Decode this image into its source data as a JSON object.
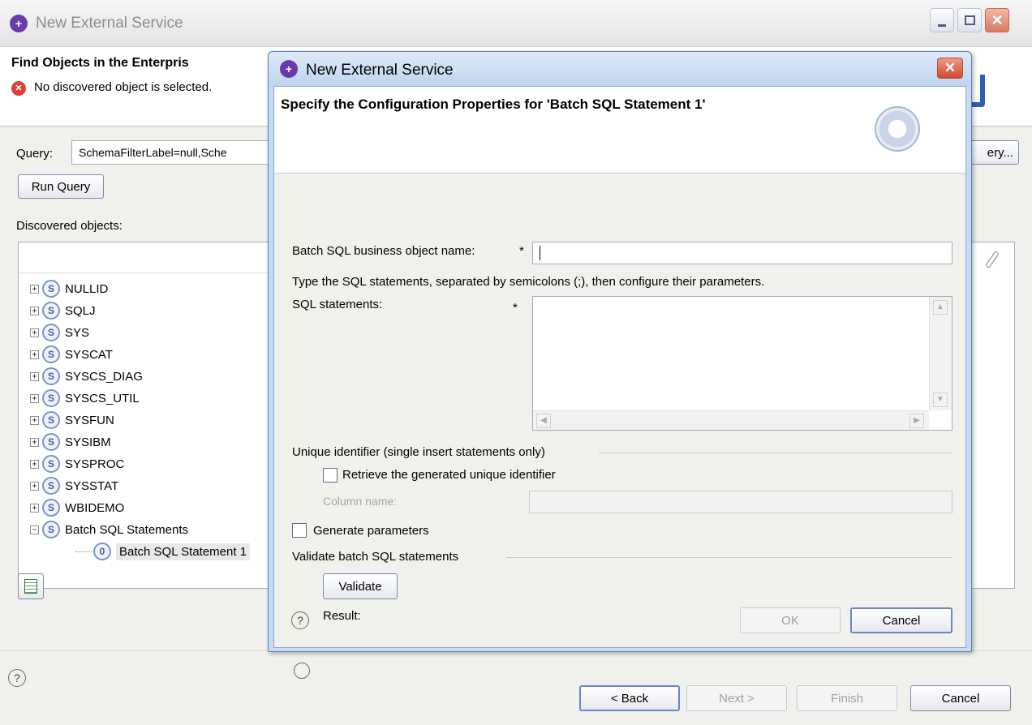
{
  "outer": {
    "title": "New External Service",
    "header_title": "Find Objects in the Enterpris",
    "error_message": "No discovered object is selected.",
    "query_label": "Query:",
    "query_value": "SchemaFilterLabel=null,Sche",
    "edit_query_label": "ery...",
    "run_query_label": "Run Query",
    "discovered_label": "Discovered objects:",
    "tree": [
      {
        "label": "NULLID",
        "expander": "+"
      },
      {
        "label": "SQLJ",
        "expander": "+"
      },
      {
        "label": "SYS",
        "expander": "+"
      },
      {
        "label": "SYSCAT",
        "expander": "+"
      },
      {
        "label": "SYSCS_DIAG",
        "expander": "+"
      },
      {
        "label": "SYSCS_UTIL",
        "expander": "+"
      },
      {
        "label": "SYSFUN",
        "expander": "+"
      },
      {
        "label": "SYSIBM",
        "expander": "+"
      },
      {
        "label": "SYSPROC",
        "expander": "+"
      },
      {
        "label": "SYSSTAT",
        "expander": "+"
      },
      {
        "label": "WBIDEMO",
        "expander": "+"
      },
      {
        "label": "Batch SQL Statements",
        "expander": "−"
      },
      {
        "label": "Batch SQL Statement 1",
        "expander": ""
      }
    ],
    "footer": {
      "back_label": "< Back",
      "next_label": "Next >",
      "finish_label": "Finish",
      "cancel_label": "Cancel"
    }
  },
  "dialog": {
    "title": "New External Service",
    "header_title": "Specify the Configuration Properties for 'Batch SQL Statement 1'",
    "bo_name_label": "Batch SQL business object name:",
    "required_mark": "*",
    "bo_name_value": "",
    "instructions": "Type the SQL statements, separated by semicolons (;), then configure their parameters.",
    "sql_label": "SQL statements:",
    "sql_value": "",
    "unique_group_label": "Unique identifier (single insert statements only)",
    "retrieve_label": "Retrieve the generated unique identifier",
    "column_name_label": "Column name:",
    "column_name_value": "",
    "generate_params_label": "Generate parameters",
    "validate_group_label": "Validate batch SQL statements",
    "validate_button": "Validate",
    "result_label": "Result:",
    "ok_label": "OK",
    "cancel_label": "Cancel"
  },
  "colors": {
    "dialog_frame": "#c7daf3",
    "window_bg": "#f0f0ec",
    "error_red": "#d9413b"
  }
}
